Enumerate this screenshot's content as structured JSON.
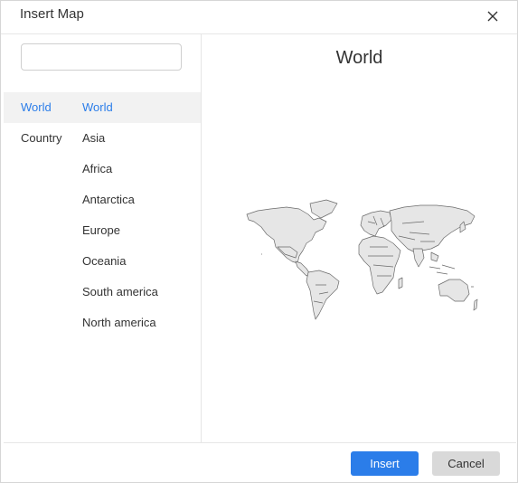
{
  "dialog": {
    "title": "Insert Map",
    "close_icon": "close-icon"
  },
  "search": {
    "value": "",
    "placeholder": ""
  },
  "categories": [
    {
      "label": "World",
      "selected": true
    },
    {
      "label": "Country",
      "selected": false
    }
  ],
  "items": [
    {
      "label": "World",
      "selected": true
    },
    {
      "label": "Asia",
      "selected": false
    },
    {
      "label": "Africa",
      "selected": false
    },
    {
      "label": "Antarctica",
      "selected": false
    },
    {
      "label": "Europe",
      "selected": false
    },
    {
      "label": "Oceania",
      "selected": false
    },
    {
      "label": "South america",
      "selected": false
    },
    {
      "label": "North america",
      "selected": false
    }
  ],
  "preview": {
    "title": "World",
    "image_icon": "world-map-icon"
  },
  "footer": {
    "insert_label": "Insert",
    "cancel_label": "Cancel"
  },
  "colors": {
    "accent": "#2b7de9",
    "selected_row": "#f2f2f2",
    "map_fill": "#e6e6e6",
    "map_stroke": "#6a6a6a"
  }
}
